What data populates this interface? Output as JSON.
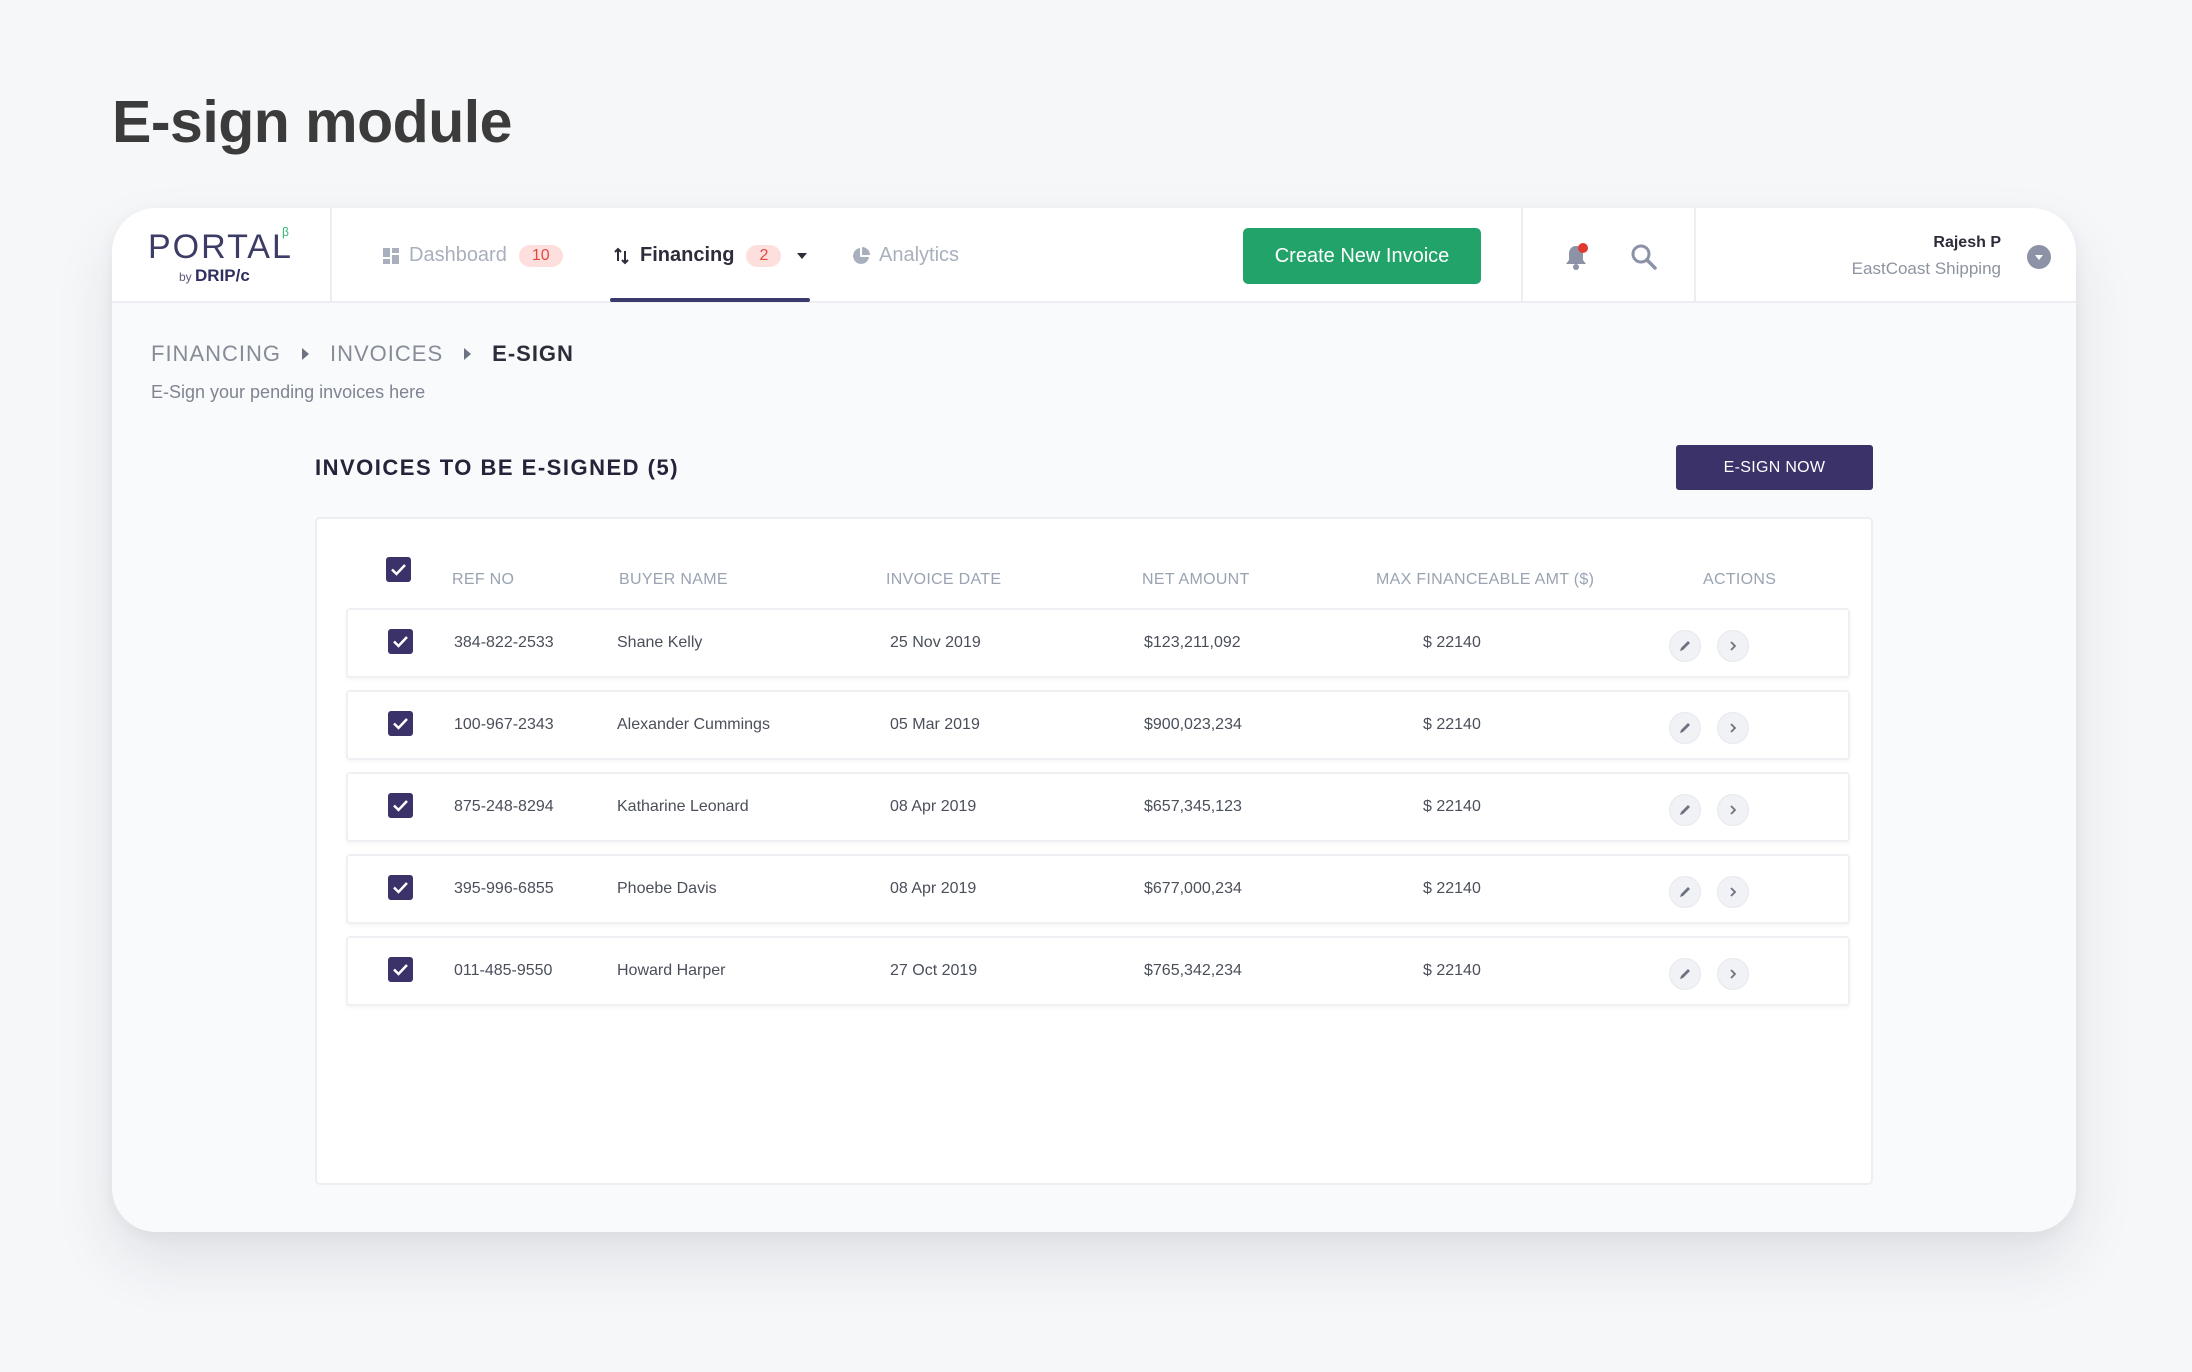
{
  "page": {
    "title": "E-sign module"
  },
  "logo": {
    "name": "PORTAL",
    "beta": "β",
    "by": "by",
    "brand": "DRIP/c"
  },
  "nav": {
    "dashboard": {
      "label": "Dashboard",
      "badge": "10"
    },
    "financing": {
      "label": "Financing",
      "badge": "2"
    },
    "analytics": {
      "label": "Analytics"
    }
  },
  "toolbar": {
    "create_label": "Create New Invoice"
  },
  "user": {
    "name": "Rajesh P",
    "company": "EastCoast Shipping"
  },
  "breadcrumb": [
    "FINANCING",
    "INVOICES",
    "E-SIGN"
  ],
  "subtitle": "E-Sign your pending invoices here",
  "section": {
    "title": "INVOICES TO BE E-SIGNED (5)",
    "esign_label": "E-SIGN NOW"
  },
  "table": {
    "headers": [
      "REF NO",
      "BUYER NAME",
      "INVOICE DATE",
      "NET AMOUNT",
      "MAX FINANCEABLE AMT ($)",
      "ACTIONS"
    ],
    "rows": [
      {
        "ref": "384-822-2533",
        "buyer": "Shane Kelly",
        "date": "25 Nov 2019",
        "net": "$123,211,092",
        "max": "$ 22140",
        "checked": true
      },
      {
        "ref": "100-967-2343",
        "buyer": "Alexander Cummings",
        "date": "05 Mar 2019",
        "net": "$900,023,234",
        "max": "$ 22140",
        "checked": true
      },
      {
        "ref": "875-248-8294",
        "buyer": "Katharine Leonard",
        "date": "08 Apr 2019",
        "net": "$657,345,123",
        "max": "$ 22140",
        "checked": true
      },
      {
        "ref": "395-996-6855",
        "buyer": "Phoebe Davis",
        "date": "08 Apr 2019",
        "net": "$677,000,234",
        "max": "$ 22140",
        "checked": true
      },
      {
        "ref": "011-485-9550",
        "buyer": "Howard Harper",
        "date": "27 Oct 2019",
        "net": "$765,342,234",
        "max": "$ 22140",
        "checked": true
      }
    ]
  },
  "colors": {
    "accent": "#3a3268",
    "primary_green": "#22a36a",
    "badge_red": "#e2483d",
    "notification_dot": "#e03a2f"
  },
  "icons": [
    "dashboard-icon",
    "financing-icon",
    "chevron-down-icon",
    "analytics-icon",
    "bell-icon",
    "search-icon",
    "user-menu-chevron-icon",
    "check-icon",
    "edit-icon",
    "chevron-right-icon"
  ]
}
